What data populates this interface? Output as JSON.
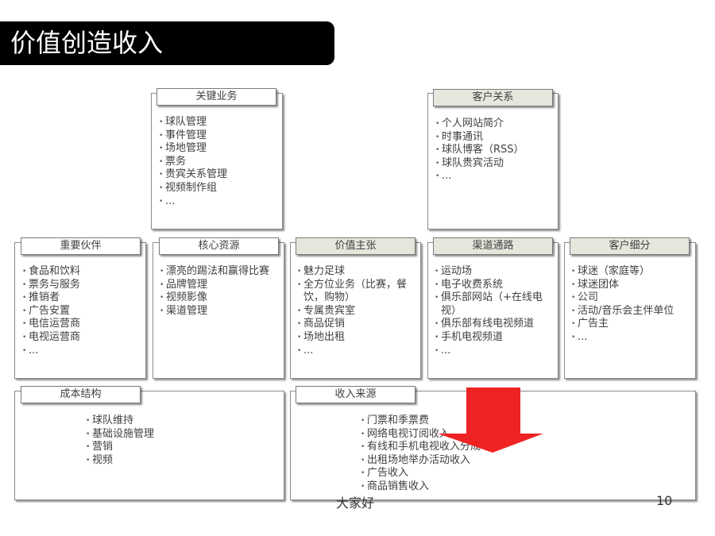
{
  "header": {
    "title": "价值创造收入"
  },
  "key_activities": {
    "label": "关键业务",
    "items": [
      "球队管理",
      "事件管理",
      "场地管理",
      "票务",
      "贵宾关系管理",
      "视频制作组",
      "..."
    ]
  },
  "customer_relationships": {
    "label": "客户关系",
    "items": [
      "个人网站简介",
      "时事通讯",
      "球队博客（RSS）",
      "球队贵宾活动",
      "..."
    ]
  },
  "key_partners": {
    "label": "重要伙伴",
    "items": [
      "食品和饮料",
      "票务与服务",
      "推销者",
      "广告安置",
      "电信运营商",
      "电视运营商",
      "..."
    ]
  },
  "key_resources": {
    "label": "核心资源",
    "items": [
      "漂亮的踢法和赢得比赛",
      "品牌管理",
      "视频影像",
      "渠道管理"
    ]
  },
  "value_propositions": {
    "label": "价值主张",
    "items": [
      "魅力足球",
      "全方位业务（比赛，餐饮，购物）",
      "专属贵宾室",
      "商品促销",
      "场地出租",
      "..."
    ]
  },
  "channels": {
    "label": "渠道通路",
    "items": [
      "运动场",
      "电子收费系统",
      "俱乐部网站（+在线电视）",
      "俱乐部有线电视频道",
      "手机电视频道",
      "..."
    ]
  },
  "customer_segments": {
    "label": "客户细分",
    "items": [
      "球迷（家庭等）",
      "球迷团体",
      "公司",
      "活动/音乐会主伴单位",
      "广告主",
      "..."
    ]
  },
  "cost_structure": {
    "label": "成本结构",
    "items": [
      "球队维持",
      "基础设施管理",
      "营销",
      "视频"
    ]
  },
  "revenue_streams": {
    "label": "收入来源",
    "items": [
      "门票和季票费",
      "网络电视订阅收入",
      "有线和手机电视收入分成",
      "出租场地举办活动收入",
      "广告收入",
      "商品销售收入"
    ]
  },
  "footer": {
    "text": "大家好",
    "page_number": "10"
  },
  "colors": {
    "arrow": "#ee1c1c",
    "title_bar": "#000000",
    "tab_shaded": "#e4e8dc"
  },
  "icons": {
    "arrow": "down-arrow-icon"
  }
}
